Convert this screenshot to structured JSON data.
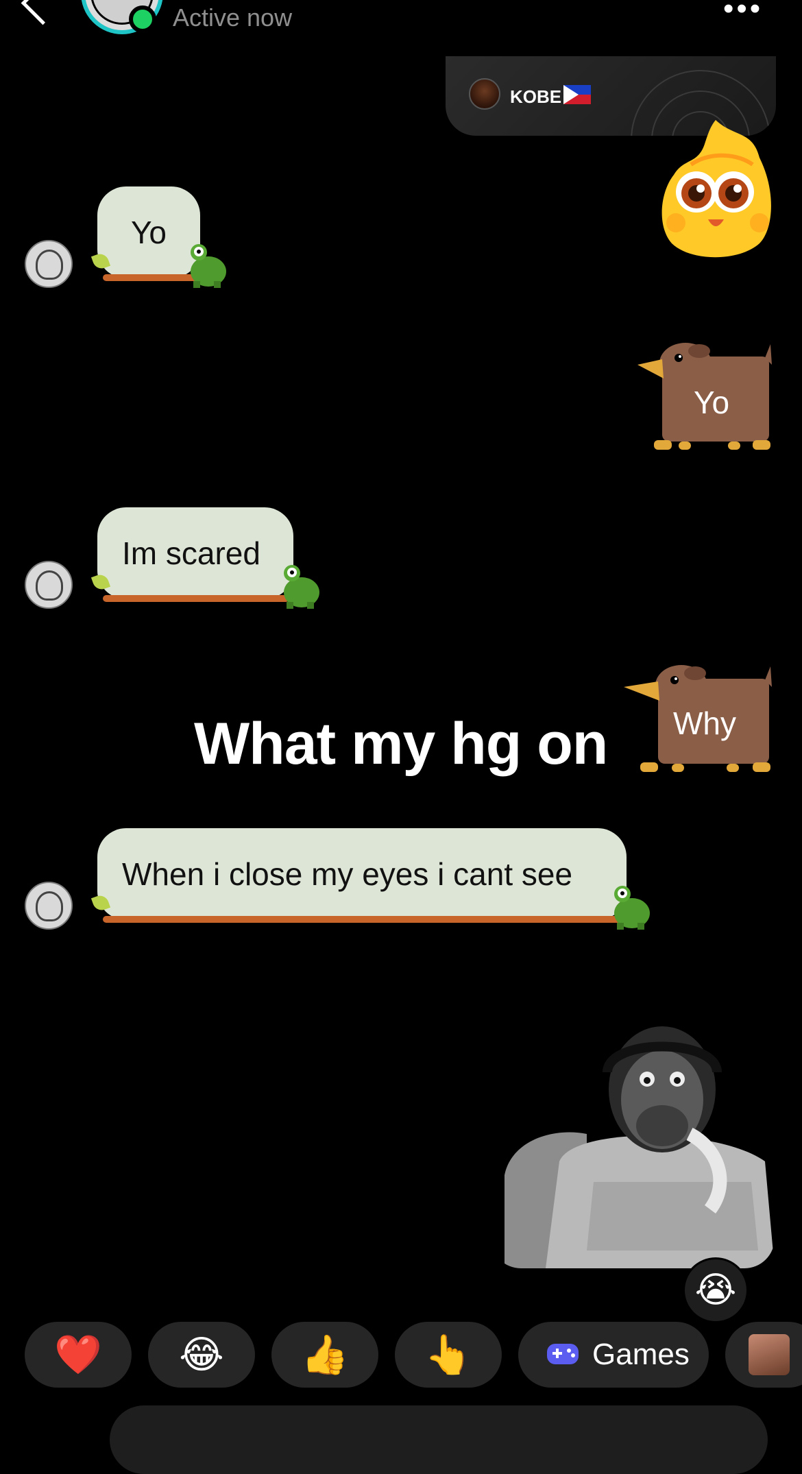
{
  "header": {
    "status": "Active now",
    "back_icon": "chevron-left-icon",
    "more_icon": "more-dots-icon",
    "more_glyph": "•••"
  },
  "story_reply": {
    "name": "KOBE",
    "flag_icon": "philippines-flag-icon"
  },
  "messages": {
    "in_1": "Yo",
    "out_1": "Yo",
    "in_2": "Im scared",
    "out_2": "Why",
    "in_3": "When i close my eyes i cant see",
    "overlay_text": "What my hg on",
    "reaction_emoji": "😭"
  },
  "quick_reactions": {
    "heart": "❤️",
    "laugh": "😂",
    "thumbs_up": "👍",
    "point": "👆",
    "games_label": "Games",
    "games_icon": "gamepad-icon"
  },
  "colors": {
    "incoming_bubble": "#dde6d6",
    "active_ring": "#1fc5c6",
    "online_dot": "#1dd163",
    "games_icon": "#5b5cf0",
    "dog_body": "#8b5e48"
  }
}
